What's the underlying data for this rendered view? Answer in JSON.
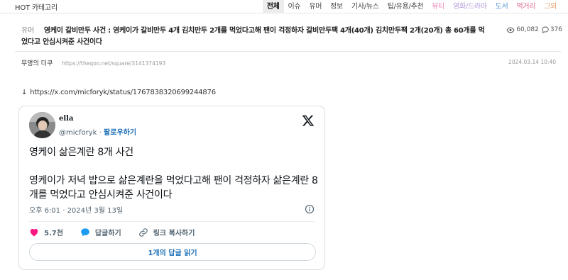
{
  "topbar": {
    "hot_label": "HOT 카테고리",
    "categories": [
      {
        "label": "전체",
        "color": "#111111"
      },
      {
        "label": "이슈",
        "color": "#444444"
      },
      {
        "label": "유머",
        "color": "#444444"
      },
      {
        "label": "정보",
        "color": "#444444"
      },
      {
        "label": "기사/뉴스",
        "color": "#444444"
      },
      {
        "label": "팁/유용/추천",
        "color": "#444444"
      },
      {
        "label": "뷰티",
        "color": "#e889b8"
      },
      {
        "label": "영화/드라마",
        "color": "#b49bd9"
      },
      {
        "label": "도서",
        "color": "#5b9bd5"
      },
      {
        "label": "먹거리",
        "color": "#d86a8b"
      },
      {
        "label": "그외",
        "color": "#e8a06a"
      }
    ],
    "active_index": 0
  },
  "post": {
    "category": "유머",
    "title": "영케이 갈비만두 사건 : 영케이가 갈비만두 4개 김치만두 2개를 먹었다고해 팬이 걱정하자 갈비만두팩 4개(40개) 김치만두팩 2개(20개) 총 60개를 먹었다고 안심시켜준 사건이다",
    "views": "60,082",
    "comments": "376",
    "author": "무명의 더쿠",
    "url": "https://theqoo.net/square/3141374193",
    "date": "2024.03.14 10:40"
  },
  "source": {
    "arrow": "↓",
    "link": "https://x.com/micforyk/status/1767838320699244876"
  },
  "tweet": {
    "display_name": "ella",
    "handle": "@micforyk",
    "separator": "·",
    "follow_label": "팔로우하기",
    "paragraph1": "영케이 삶은계란 8개 사건",
    "paragraph2": "영케이가 저녁 밥으로 삶은계란을 먹었다고해 팬이 걱정하자 삶은계란 8개를 먹었다고 안심시켜준 사건이다",
    "timestamp": "오후 6:01 · 2024년 3월 13일",
    "likes": "5.7천",
    "reply_label": "답글하기",
    "copy_link_label": "링크 복사하기",
    "read_replies_label": "1개의 답글 읽기",
    "colors": {
      "like": "#f91880",
      "reply": "#1d9bf0",
      "link": "#1d6fb8"
    }
  }
}
